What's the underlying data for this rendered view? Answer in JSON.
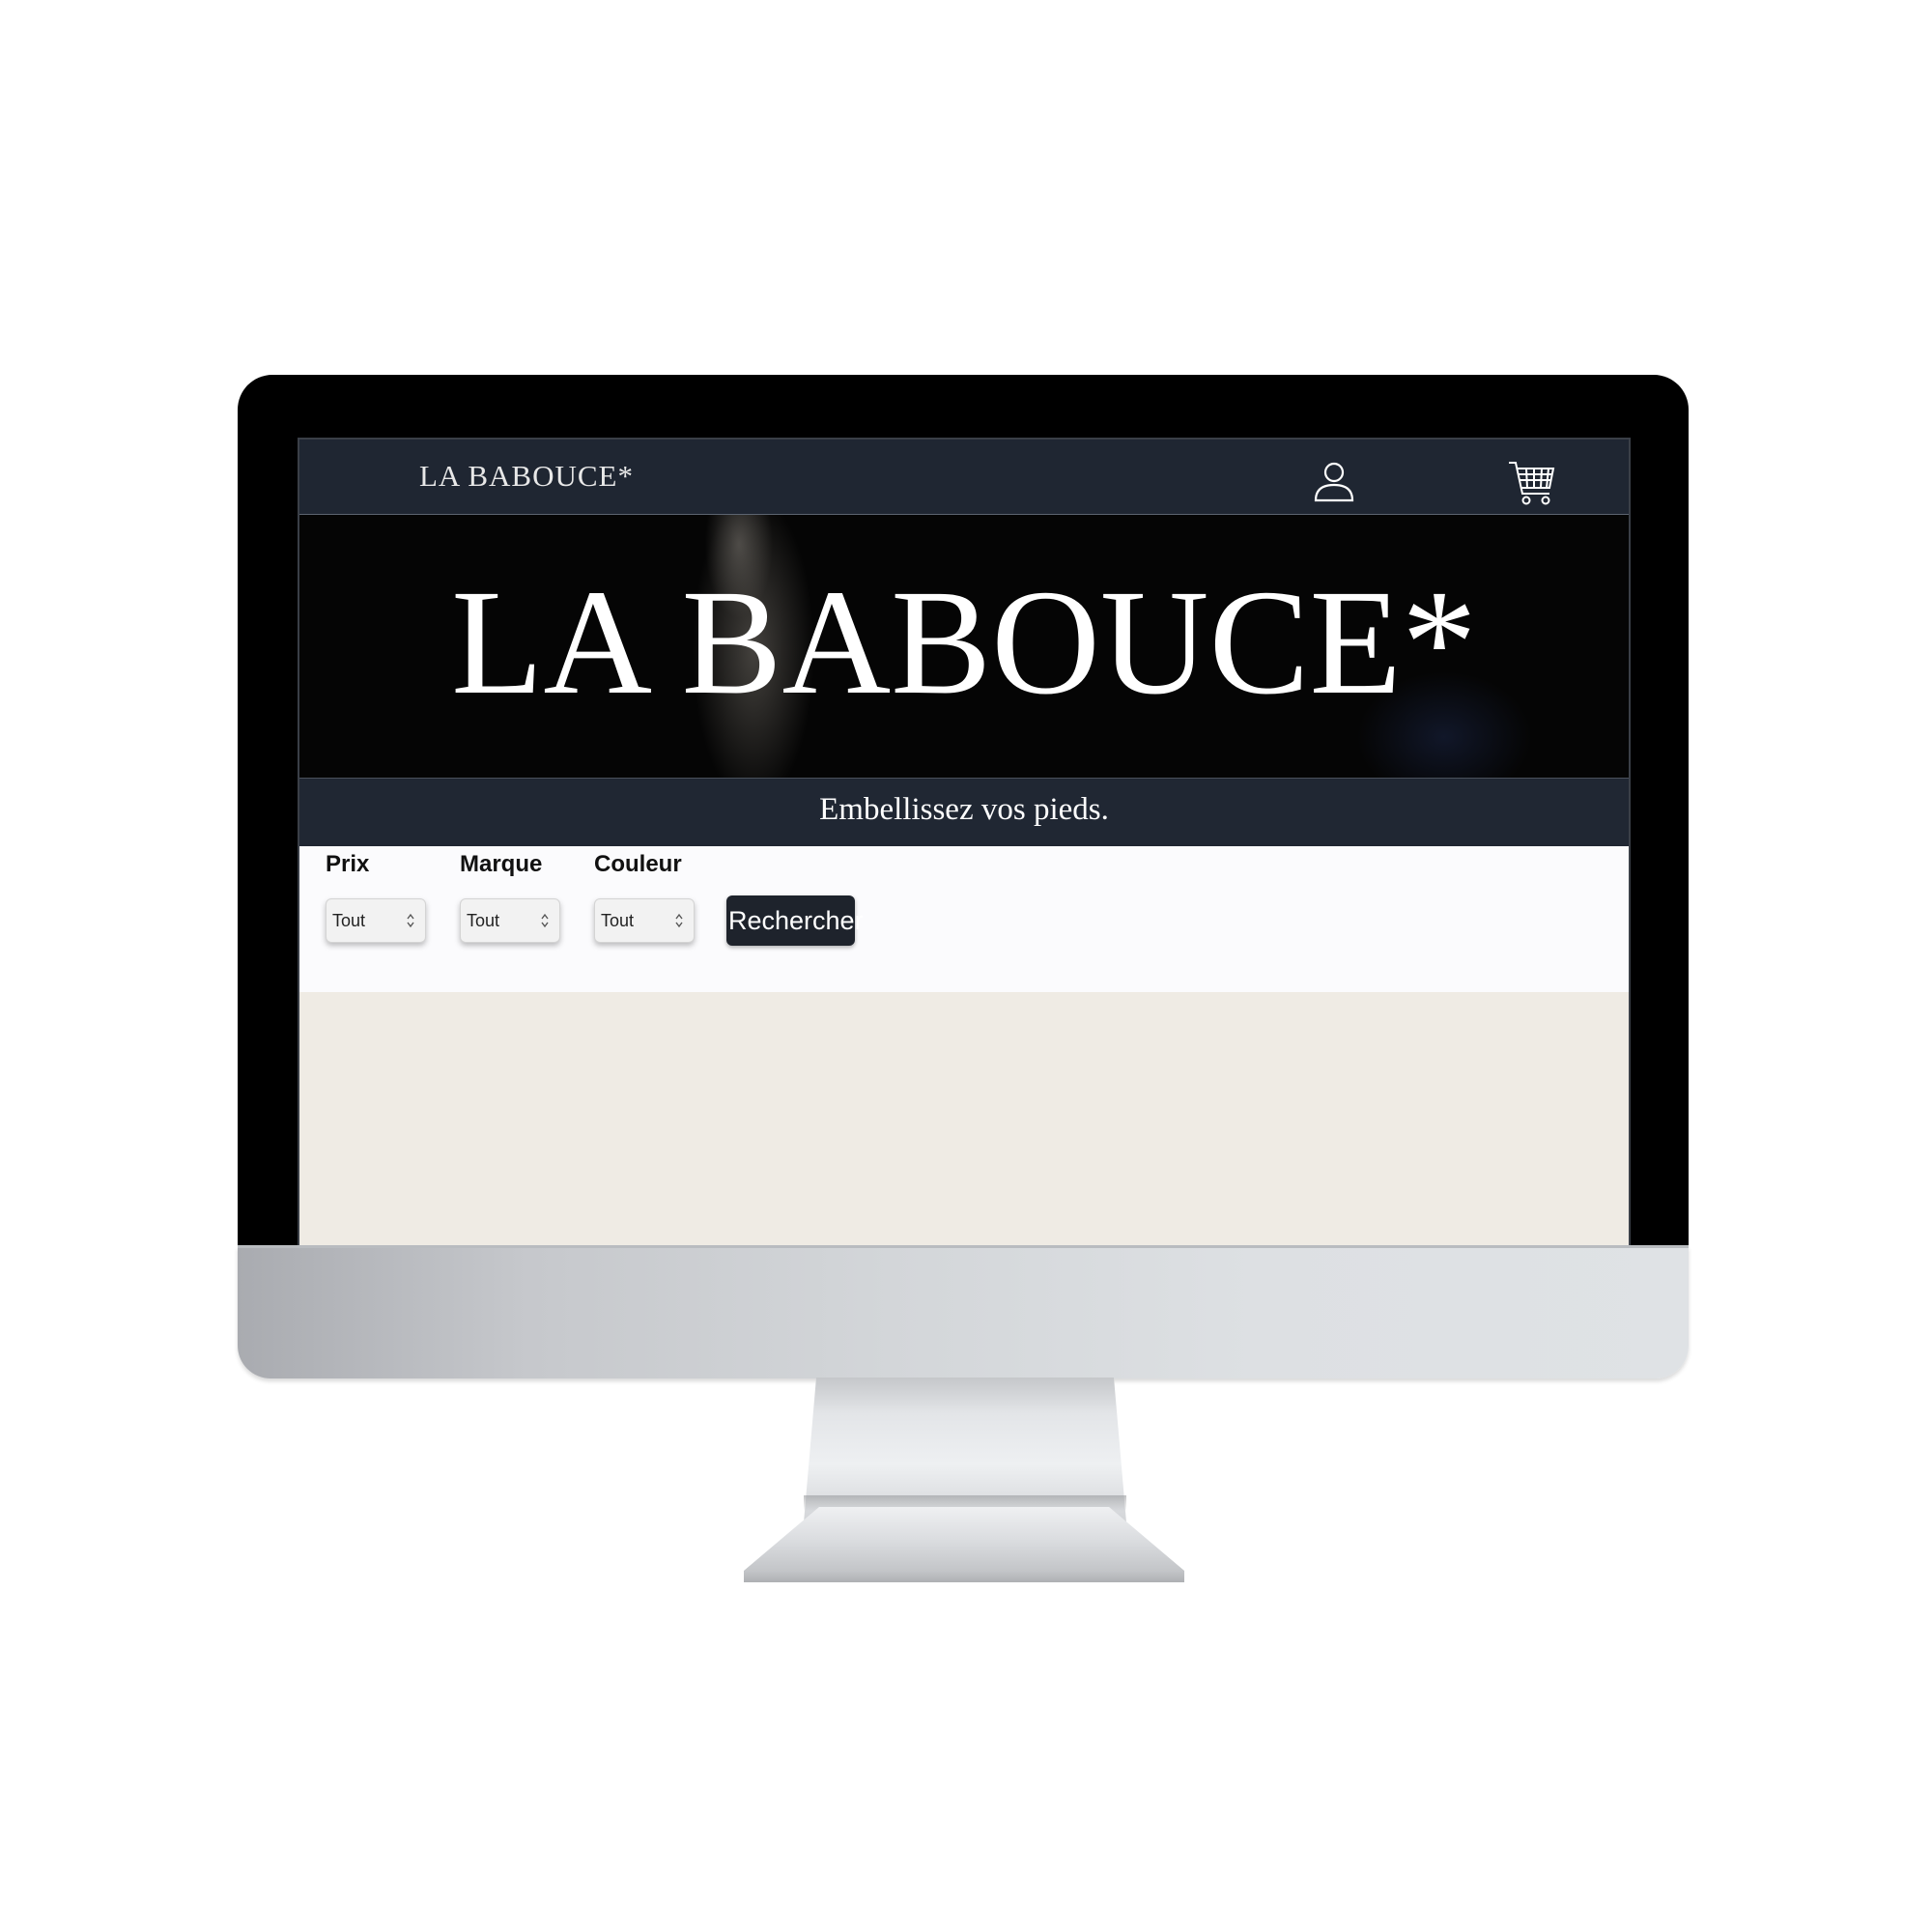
{
  "navbar": {
    "logo": "LA BABOUCE*",
    "icons": [
      "user-icon",
      "cart-icon"
    ]
  },
  "hero": {
    "title": "LA BABOUCE*"
  },
  "tagline": "Embellissez vos pieds.",
  "filters": {
    "price": {
      "label": "Prix",
      "value": "Tout"
    },
    "brand": {
      "label": "Marque",
      "value": "Tout"
    },
    "color": {
      "label": "Couleur",
      "value": "Tout"
    },
    "search_label": "Rechercher"
  },
  "colors": {
    "navbar": "#1f2632",
    "hero_bg": "#050505",
    "filter_bg": "#fbfbfd",
    "content_bg": "#efebe4",
    "button_bg": "#1e232c"
  }
}
